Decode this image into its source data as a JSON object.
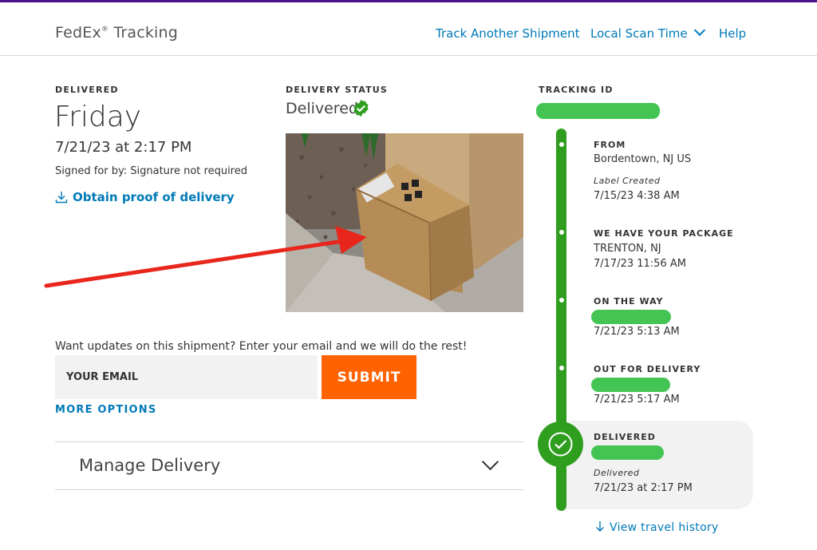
{
  "header": {
    "brand": "FedEx",
    "brand_reg": "®",
    "brand_suffix": "Tracking",
    "nav": {
      "track_another": "Track Another Shipment",
      "local_scan_time": "Local Scan Time",
      "help": "Help"
    }
  },
  "summary": {
    "status_label": "DELIVERED",
    "day": "Friday",
    "datetime": "7/21/23 at 2:17 PM",
    "signed_for": "Signed for by: Signature not required",
    "proof_link": "Obtain proof of delivery"
  },
  "delivery_status": {
    "label": "DELIVERY STATUS",
    "value": "Delivered"
  },
  "updates": {
    "prompt": "Want updates on this shipment? Enter your email and we will do the rest!",
    "email_placeholder": "YOUR EMAIL",
    "submit_label": "SUBMIT",
    "more_options": "MORE OPTIONS"
  },
  "manage": {
    "title": "Manage Delivery"
  },
  "tracking": {
    "label": "TRACKING ID",
    "events": [
      {
        "label": "FROM",
        "location": "Bordentown, NJ US",
        "note": "Label Created",
        "time": "7/15/23 4:38 AM"
      },
      {
        "label": "WE HAVE YOUR PACKAGE",
        "location": "TRENTON, NJ",
        "time": "7/17/23 11:56 AM"
      },
      {
        "label": "ON THE WAY",
        "time": "7/21/23 5:13 AM"
      },
      {
        "label": "OUT FOR DELIVERY",
        "time": "7/21/23 5:17 AM"
      },
      {
        "label": "DELIVERED",
        "note": "Delivered",
        "time": "7/21/23 at 2:17 PM"
      }
    ],
    "history_link": "View travel history"
  },
  "colors": {
    "fedex_purple": "#4d148c",
    "link_blue": "#007ab7",
    "submit_orange": "#ff6200",
    "timeline_green": "#2f9e1f",
    "redaction_green": "#44c553",
    "annotation_red": "#e8261b"
  }
}
